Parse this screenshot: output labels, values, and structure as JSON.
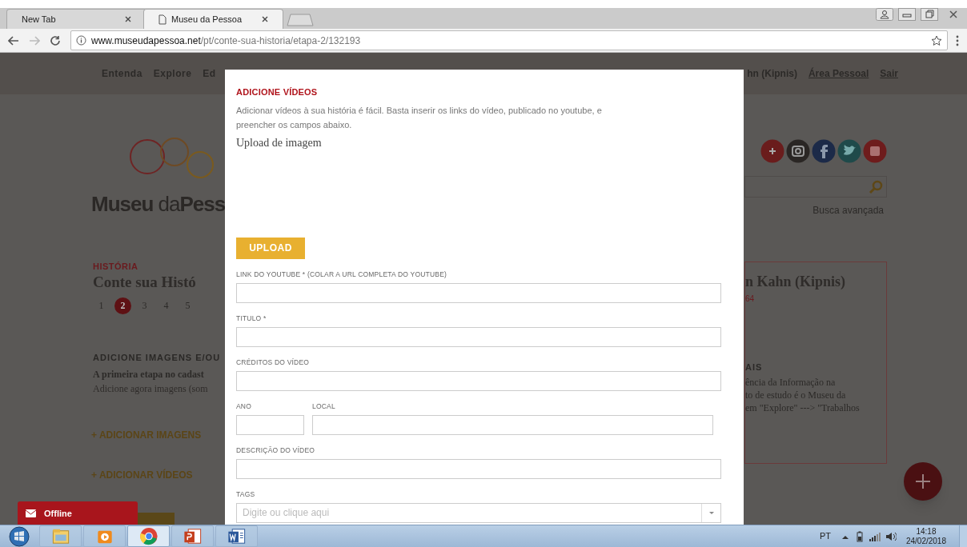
{
  "browser": {
    "tabs": [
      {
        "title": "New Tab",
        "selected": false
      },
      {
        "title": "Museu da Pessoa",
        "selected": true
      }
    ],
    "url_host": "www.museudapessoa.net",
    "url_path": "/pt/conte-sua-historia/etapa-2/132193"
  },
  "site": {
    "nav_left": [
      "Entenda",
      "Explore",
      "Ed"
    ],
    "nav_right": [
      {
        "label": "hn (Kipnis)",
        "underlined": false
      },
      {
        "label": "Área Pessoal",
        "underlined": true
      },
      {
        "label": "Sair",
        "underlined": true
      }
    ],
    "logo_text": "**Museu** da**Pess**",
    "section_label": "HISTÓRIA",
    "title": "Conte sua Histó",
    "steps": [
      {
        "label": "1",
        "selected": false
      },
      {
        "label": "2",
        "selected": true
      },
      {
        "label": "3",
        "selected": false
      },
      {
        "label": "4",
        "selected": false
      },
      {
        "label": "5",
        "selected": false
      }
    ],
    "subheading": "ADICIONE IMAGENS E/OU",
    "lead": "A primeira etapa no cadast",
    "text": "Adicione agora imagens (som",
    "actions": [
      "+ ADICIONAR IMAGENS",
      "+ ADICIONAR VÍDEOS"
    ],
    "search_link": "Busca avançada",
    "card": {
      "title": "n Kahn (Kipnis)",
      "date": "64",
      "heading": "AIS",
      "lines": [
        "ência da Informação na",
        "to de estudo é o Museu da",
        "em \"Explore\" ---> \"Trabalhos"
      ]
    },
    "chat": "Offline"
  },
  "modal": {
    "title": "ADICIONE VÍDEOS",
    "intro": "Adicionar vídeos à sua história é fácil. Basta inserir os links do vídeo, publicado no youtube, e preencher os campos abaixo.",
    "upload_heading": "Upload de imagem",
    "upload_button": "UPLOAD",
    "rows": [
      [
        {
          "kind": "text",
          "label": "LINK DO YOUTUBE * (COLAR A URL COMPLETA DO YOUTUBE)"
        }
      ],
      [
        {
          "kind": "text",
          "label": "TITULO *"
        }
      ],
      [
        {
          "kind": "text",
          "label": "CRÉDITOS DO VÍDEO"
        }
      ],
      [
        {
          "kind": "short",
          "label": "ANO"
        },
        {
          "kind": "text",
          "label": "LOCAL"
        }
      ],
      [
        {
          "kind": "text",
          "label": "DESCRIÇÃO DO VÍDEO"
        }
      ],
      [
        {
          "kind": "select",
          "label": "TAGS",
          "placeholder": "Digite ou clique aqui"
        }
      ]
    ]
  },
  "taskbar": {
    "language": "PT",
    "time": "14:18",
    "date": "24/02/2018"
  }
}
